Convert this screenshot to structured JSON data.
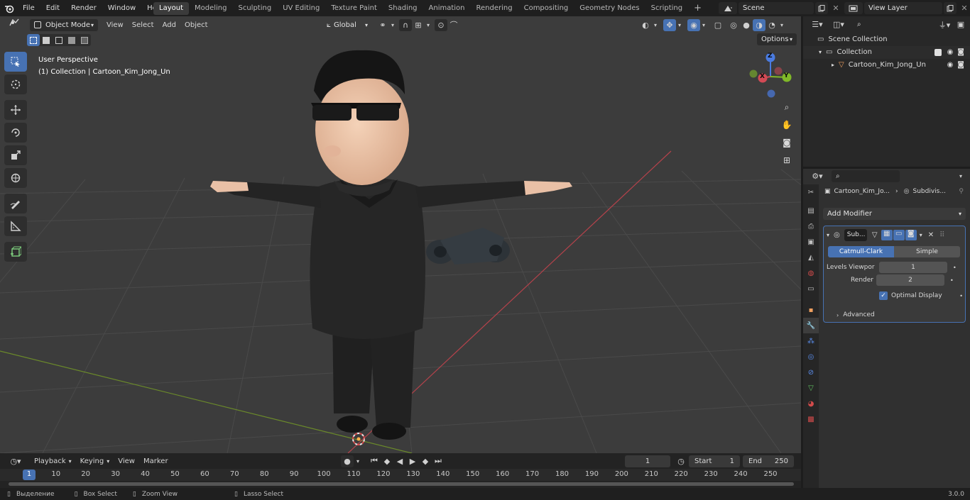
{
  "menu": [
    "File",
    "Edit",
    "Render",
    "Window",
    "Help"
  ],
  "workspace_tabs": [
    "Layout",
    "Modeling",
    "Sculpting",
    "UV Editing",
    "Texture Paint",
    "Shading",
    "Animation",
    "Rendering",
    "Compositing",
    "Geometry Nodes",
    "Scripting"
  ],
  "active_workspace": "Layout",
  "add_workspace": "+",
  "scene": {
    "name": "Scene",
    "view_layer": "View Layer"
  },
  "viewport": {
    "mode": "Object Mode",
    "menu": [
      "View",
      "Select",
      "Add",
      "Object"
    ],
    "transform_orientation": "Global",
    "options_label": "Options",
    "info_line1": "User Perspective",
    "info_line2": "(1) Collection | Cartoon_Kim_Jong_Un",
    "gizmo": {
      "z": "Z",
      "x": "X",
      "y": "Y"
    }
  },
  "outliner": {
    "scene_collection": "Scene Collection",
    "collection": "Collection",
    "object": "Cartoon_Kim_Jong_Un"
  },
  "properties": {
    "breadcrumb_object": "Cartoon_Kim_Jo...",
    "breadcrumb_modifier": "Subdivis...",
    "add_modifier": "Add Modifier",
    "modifier_name": "Sub...",
    "algo_catmull": "Catmull-Clark",
    "algo_simple": "Simple",
    "levels_viewport_label": "Levels Viewpor",
    "levels_viewport_value": "1",
    "render_label": "Render",
    "render_value": "2",
    "optimal_display": "Optimal Display",
    "advanced": "Advanced"
  },
  "timeline": {
    "menu": [
      "Playback",
      "Keying",
      "View",
      "Marker"
    ],
    "current_frame": "1",
    "start_label": "Start",
    "start_value": "1",
    "end_label": "End",
    "end_value": "250",
    "ticks": [
      "1",
      "10",
      "20",
      "30",
      "40",
      "50",
      "60",
      "70",
      "80",
      "90",
      "100",
      "110",
      "120",
      "130",
      "140",
      "150",
      "160",
      "170",
      "180",
      "190",
      "200",
      "210",
      "220",
      "230",
      "240",
      "250"
    ]
  },
  "statusbar": {
    "select": "Выделение",
    "box_select": "Box Select",
    "zoom_view": "Zoom View",
    "lasso_select": "Lasso Select",
    "version": "3.0.0"
  },
  "colors": {
    "accent": "#4772b3",
    "viewport_bg": "#3c3c3c",
    "x_axis": "#c53c47",
    "y_axis": "#7a9a2e"
  }
}
